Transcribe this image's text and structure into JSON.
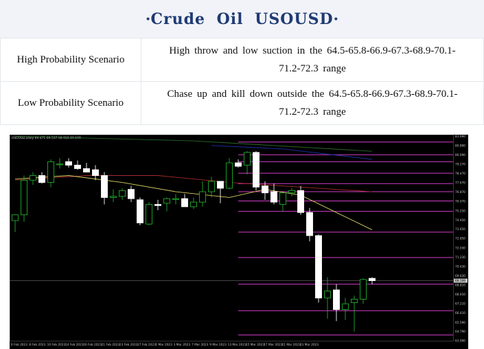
{
  "header": {
    "title": "Crude  Oil  USOUSD",
    "dot": "·"
  },
  "scenarios": [
    {
      "label": "High Probability Scenario",
      "line1": "High throw and low suction in the 64.5-65.8-66.9-67.3-68.9-70.1-",
      "line2": "71.2-72.3  range"
    },
    {
      "label": "Low Probability Scenario",
      "line1": "Chase up and kill down outside the 64.5-65.8-66.9-67.3-68.9-70.1-",
      "line2": "71.2-72.3  range"
    }
  ],
  "chart_data": {
    "type": "candlestick",
    "header": "USOUSD,Daily  69.471 69.537 68.916 69.199",
    "ylim": [
      64.0,
      81.6
    ],
    "y_ticks": [
      "81.690",
      "80.890",
      "80.090",
      "79.270",
      "78.470",
      "77.670",
      "76.870",
      "76.070",
      "75.250",
      "74.450",
      "73.650",
      "72.850",
      "72.030",
      "71.230",
      "70.430",
      "69.630",
      "68.810",
      "68.010",
      "67.210",
      "66.410",
      "65.590",
      "64.790",
      "63.990"
    ],
    "x_labels": [
      "6 Feb 2023",
      "8 Feb 2023",
      "10 Feb 2023",
      "14 Feb 2023",
      "16 Feb 2023",
      "21 Feb 2023",
      "23 Feb 2023",
      "27 Feb 2023",
      "1 Mar 2023",
      "3 Mar 2023",
      "7 Mar 2023",
      "9 Mar 2023",
      "13 Mar 2023",
      "15 Mar 2023",
      "17 Mar 2023",
      "21 Mar 2023",
      "23 Mar 2023"
    ],
    "current_price": "69.199",
    "levels": [
      81.2,
      80.1,
      79.5,
      78.5,
      77.6,
      76.9,
      76.1,
      75.2,
      73.4,
      71.2,
      68.9,
      66.6,
      64.5
    ],
    "candles": [
      {
        "o": 74.4,
        "h": 74.9,
        "l": 73.4,
        "c": 74.9
      },
      {
        "o": 74.9,
        "h": 78.3,
        "l": 74.3,
        "c": 77.9
      },
      {
        "o": 77.9,
        "h": 78.6,
        "l": 77.5,
        "c": 78.3
      },
      {
        "o": 78.3,
        "h": 78.6,
        "l": 77.6,
        "c": 77.7
      },
      {
        "o": 77.7,
        "h": 79.7,
        "l": 77.3,
        "c": 79.5
      },
      {
        "o": 79.3,
        "h": 79.8,
        "l": 78.9,
        "c": 79.3
      },
      {
        "o": 79.5,
        "h": 79.8,
        "l": 79.0,
        "c": 79.2
      },
      {
        "o": 79.2,
        "h": 79.6,
        "l": 78.8,
        "c": 78.9
      },
      {
        "o": 78.9,
        "h": 79.4,
        "l": 78.6,
        "c": 78.6
      },
      {
        "o": 78.8,
        "h": 79.2,
        "l": 77.9,
        "c": 78.3
      },
      {
        "o": 78.3,
        "h": 78.6,
        "l": 75.8,
        "c": 76.4
      },
      {
        "o": 76.4,
        "h": 77.1,
        "l": 76.0,
        "c": 76.5
      },
      {
        "o": 76.5,
        "h": 77.2,
        "l": 76.2,
        "c": 77.0
      },
      {
        "o": 77.1,
        "h": 77.4,
        "l": 76.0,
        "c": 76.3
      },
      {
        "o": 76.2,
        "h": 76.4,
        "l": 74.0,
        "c": 74.2
      },
      {
        "o": 74.1,
        "h": 76.0,
        "l": 74.0,
        "c": 75.8
      },
      {
        "o": 75.8,
        "h": 76.2,
        "l": 75.3,
        "c": 75.7
      },
      {
        "o": 75.9,
        "h": 76.4,
        "l": 75.2,
        "c": 76.3
      },
      {
        "o": 76.3,
        "h": 76.7,
        "l": 75.8,
        "c": 76.3
      },
      {
        "o": 76.3,
        "h": 76.7,
        "l": 75.6,
        "c": 75.6
      },
      {
        "o": 75.6,
        "h": 76.4,
        "l": 75.4,
        "c": 76.0
      },
      {
        "o": 76.0,
        "h": 77.8,
        "l": 75.6,
        "c": 76.9
      },
      {
        "o": 76.9,
        "h": 78.2,
        "l": 76.4,
        "c": 77.8
      },
      {
        "o": 77.8,
        "h": 77.6,
        "l": 75.9,
        "c": 77.2
      },
      {
        "o": 77.2,
        "h": 79.8,
        "l": 77.1,
        "c": 79.4
      },
      {
        "o": 79.4,
        "h": 79.7,
        "l": 79.0,
        "c": 79.1
      },
      {
        "o": 79.2,
        "h": 80.4,
        "l": 78.4,
        "c": 80.3
      },
      {
        "o": 80.3,
        "h": 80.4,
        "l": 77.0,
        "c": 77.3
      },
      {
        "o": 77.4,
        "h": 77.8,
        "l": 76.2,
        "c": 76.8
      },
      {
        "o": 76.9,
        "h": 77.6,
        "l": 75.8,
        "c": 76.0
      },
      {
        "o": 75.8,
        "h": 76.8,
        "l": 75.2,
        "c": 76.8
      },
      {
        "o": 76.8,
        "h": 77.2,
        "l": 76.5,
        "c": 77.0
      },
      {
        "o": 77.0,
        "h": 77.4,
        "l": 74.9,
        "c": 75.1
      },
      {
        "o": 75.1,
        "h": 75.5,
        "l": 72.6,
        "c": 73.1
      },
      {
        "o": 73.1,
        "h": 73.2,
        "l": 67.3,
        "c": 67.7
      },
      {
        "o": 67.7,
        "h": 69.5,
        "l": 65.9,
        "c": 68.3
      },
      {
        "o": 68.4,
        "h": 68.9,
        "l": 65.7,
        "c": 66.7
      },
      {
        "o": 66.7,
        "h": 67.7,
        "l": 65.8,
        "c": 67.2
      },
      {
        "o": 67.3,
        "h": 67.9,
        "l": 64.8,
        "c": 67.6
      },
      {
        "o": 67.6,
        "h": 69.4,
        "l": 67.2,
        "c": 69.3
      },
      {
        "o": 69.4,
        "h": 69.5,
        "l": 68.9,
        "c": 69.2
      }
    ],
    "ma_series": [
      {
        "color": "#2a6b2a",
        "points": [
          [
            0,
            81.7
          ],
          [
            20,
            81.3
          ],
          [
            40,
            80.4
          ]
        ]
      },
      {
        "color": "#1c2fa8",
        "points": [
          [
            22,
            80.9
          ],
          [
            30,
            80.6
          ],
          [
            40,
            79.7
          ]
        ]
      },
      {
        "color": "#a52a2a",
        "points": [
          [
            0,
            77.9
          ],
          [
            8,
            78.3
          ],
          [
            16,
            78.3
          ],
          [
            24,
            77.7
          ],
          [
            32,
            77.3
          ],
          [
            40,
            76.9
          ]
        ]
      },
      {
        "color": "#d8d060",
        "points": [
          [
            0,
            78.0
          ],
          [
            6,
            78.3
          ],
          [
            12,
            77.7
          ],
          [
            18,
            76.9
          ],
          [
            24,
            76.4
          ],
          [
            28,
            77.1
          ],
          [
            32,
            76.6
          ],
          [
            36,
            75.1
          ],
          [
            40,
            73.6
          ]
        ]
      }
    ]
  }
}
